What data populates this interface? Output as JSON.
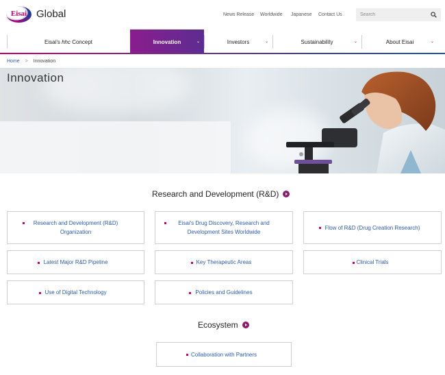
{
  "header": {
    "logo_text": "Eisai",
    "site_name": "Global",
    "utility_links": [
      "News Release",
      "Worldwide",
      "Japanese",
      "Contact Us"
    ],
    "search": {
      "placeholder": "Search",
      "icon": "search-icon"
    }
  },
  "nav": {
    "items": [
      {
        "label": "Eisai's hhc Concept",
        "active": false,
        "has_dropdown": false
      },
      {
        "label": "Innovation",
        "active": true,
        "has_dropdown": true
      },
      {
        "label": "Investors",
        "active": false,
        "has_dropdown": true
      },
      {
        "label": "Sustainability",
        "active": false,
        "has_dropdown": true
      },
      {
        "label": "About Eisai",
        "active": false,
        "has_dropdown": true
      }
    ],
    "active_color": "#7b2b90",
    "accent_color": "#c8006e"
  },
  "breadcrumb": {
    "home": "Home",
    "separator": ">",
    "current": "Innovation"
  },
  "hero": {
    "title": "Innovation"
  },
  "rnd": {
    "heading": "Research and Development (R&D)",
    "cards": [
      {
        "lines": [
          "Research and Development (R&D)",
          "Organization"
        ]
      },
      {
        "lines": [
          "Eisai's Drug Discovery, Research and",
          "Development Sites Worldwide"
        ]
      },
      {
        "lines": [
          "Flow of R&D (Drug Creation Research)"
        ]
      },
      {
        "lines": [
          "Latest Major R&D Pipeline"
        ]
      },
      {
        "lines": [
          "Key Therapeutic Areas"
        ]
      },
      {
        "lines": [
          "Clinical Trials"
        ]
      },
      {
        "lines": [
          "Use of Digital Technology"
        ]
      },
      {
        "lines": [
          "Policies and Guidelines"
        ]
      }
    ]
  },
  "ecosystem": {
    "heading": "Ecosystem",
    "cards": [
      {
        "lines": [
          "Collaboration with Partners"
        ]
      }
    ]
  },
  "colors": {
    "link": "#2a5ba8",
    "bullet": "#c8006e",
    "heading_arrow": "#8a1d6f"
  }
}
